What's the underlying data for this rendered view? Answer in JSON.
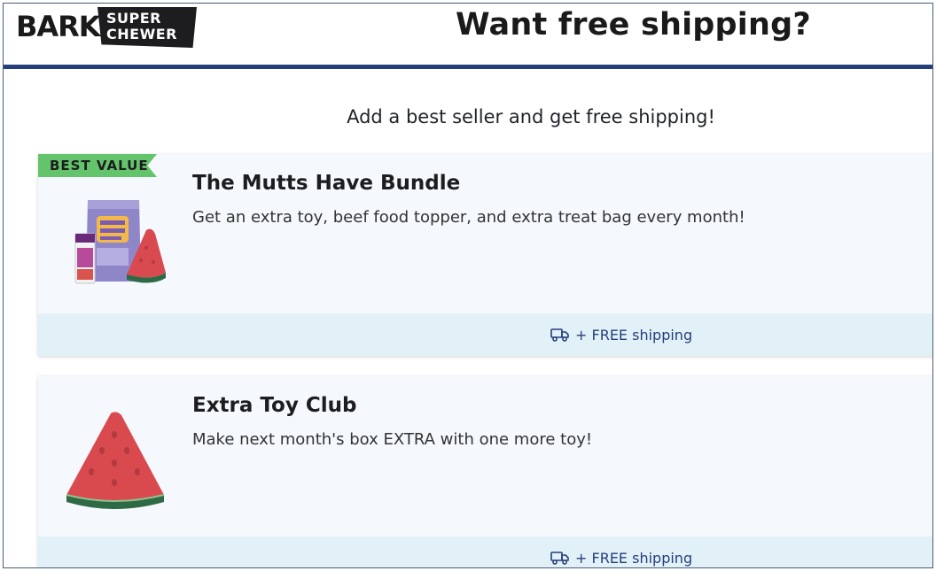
{
  "header": {
    "logo_word": "BARK",
    "logo_badge_line1": "SUPER",
    "logo_badge_line2": "CHEWER",
    "title": "Want free shipping?"
  },
  "subtitle": "Add a best seller and get free shipping!",
  "offers": [
    {
      "badge": "BEST VALUE",
      "title": "The Mutts Have Bundle",
      "description": "Get an extra toy, beef food topper, and extra treat bag every month!",
      "shipping": "+ FREE shipping",
      "icon": "truck-icon"
    },
    {
      "title": "Extra Toy Club",
      "description": "Make next month's box EXTRA with one more toy!",
      "shipping": "+ FREE shipping",
      "icon": "truck-icon"
    }
  ],
  "colors": {
    "accent_navy": "#243f7a",
    "badge_green": "#64c46b",
    "card_bg": "#f5f8fc",
    "footer_bg": "#e2f1f8"
  }
}
